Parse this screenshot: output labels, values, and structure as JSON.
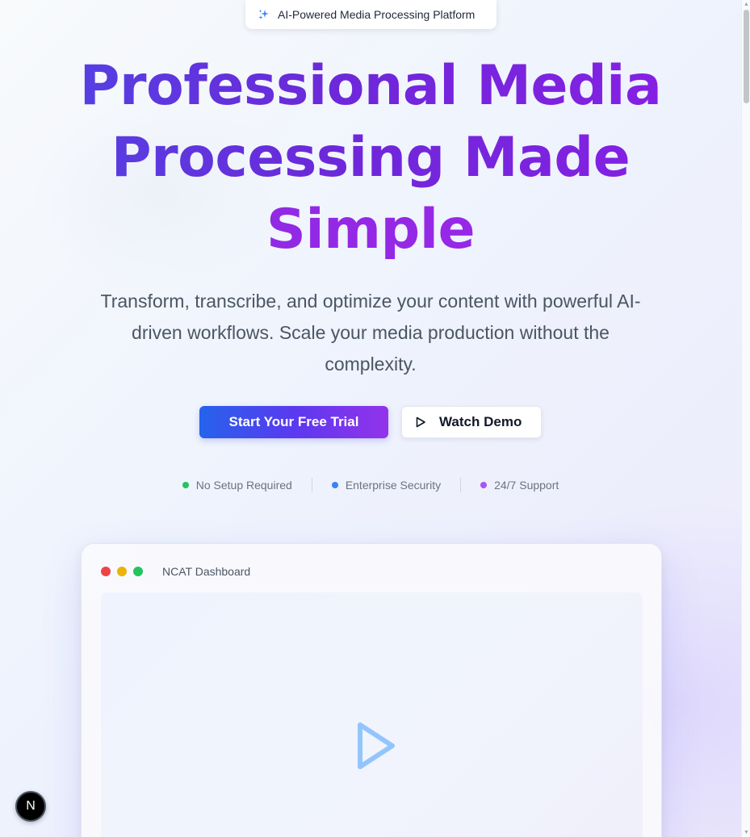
{
  "badge": {
    "icon": "sparkles-icon",
    "text": "AI-Powered Media Processing Platform"
  },
  "hero": {
    "headline_line1": "Professional Media",
    "headline_line2": "Processing Made",
    "headline_line3": "Simple",
    "subtitle": "Transform, transcribe, and optimize your content with powerful AI-driven workflows. Scale your media production without the complexity."
  },
  "cta": {
    "primary_label": "Start Your Free Trial",
    "secondary_label": "Watch Demo",
    "secondary_icon": "play-icon"
  },
  "features": [
    {
      "label": "No Setup Required",
      "color": "#22c55e"
    },
    {
      "label": "Enterprise Security",
      "color": "#3b82f6"
    },
    {
      "label": "24/7 Support",
      "color": "#a855f7"
    }
  ],
  "dashboard": {
    "title": "NCAT Dashboard",
    "window_dots": [
      "#ef4444",
      "#eab308",
      "#22c55e"
    ],
    "play_icon": "play-icon",
    "play_color": "#93c5fd"
  },
  "devtools": {
    "label": "N"
  },
  "colors": {
    "gradient_start": "#2563eb",
    "gradient_end": "#9333ea"
  }
}
